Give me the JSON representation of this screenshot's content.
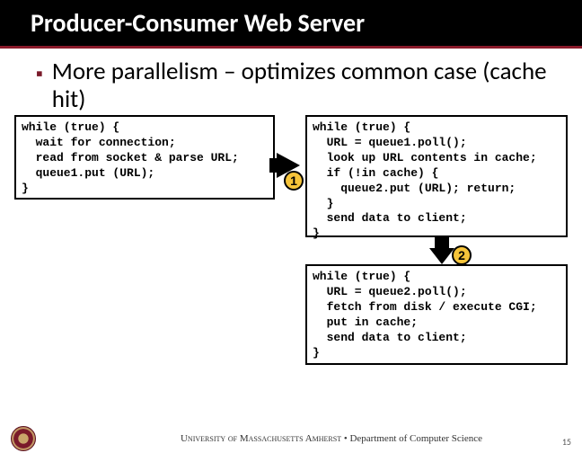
{
  "title": "Producer-Consumer Web Server",
  "bullet": "More parallelism – optimizes common case (cache hit)",
  "code": {
    "box1": "while (true) {\n  wait for connection;\n  read from socket & parse URL;\n  queue1.put (URL);\n}",
    "box2": "while (true) {\n  URL = queue1.poll();\n  look up URL contents in cache;\n  if (!in cache) {\n    queue2.put (URL); return;\n  }\n  send data to client;\n}",
    "box3": "while (true) {\n  URL = queue2.poll();\n  fetch from disk / execute CGI;\n  put in cache;\n  send data to client;\n}"
  },
  "badges": {
    "b1": "1",
    "b2": "2"
  },
  "footer": {
    "university": "University of Massachusetts Amherst",
    "sep": " • ",
    "dept": "Department of Computer Science"
  },
  "page_number": "15"
}
